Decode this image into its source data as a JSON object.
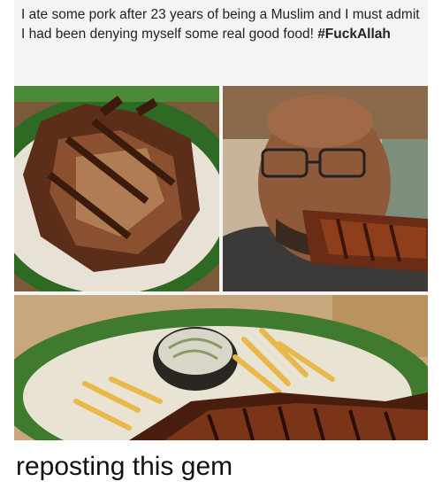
{
  "post": {
    "text_main": "I ate some pork after 23 years of being a Muslim and I must admit I had been denying myself some real good food! ",
    "hashtag": "#FuckAllah"
  },
  "images": [
    {
      "subject": "plate of ribs"
    },
    {
      "subject": "man eating ribs"
    },
    {
      "subject": "ribs with fries and coleslaw"
    }
  ],
  "caption": "reposting this gem",
  "colors": {
    "card_bg": "#f4f4f4",
    "plate_green": "#3f7a2e",
    "rib_brown": "#5a2e18"
  }
}
